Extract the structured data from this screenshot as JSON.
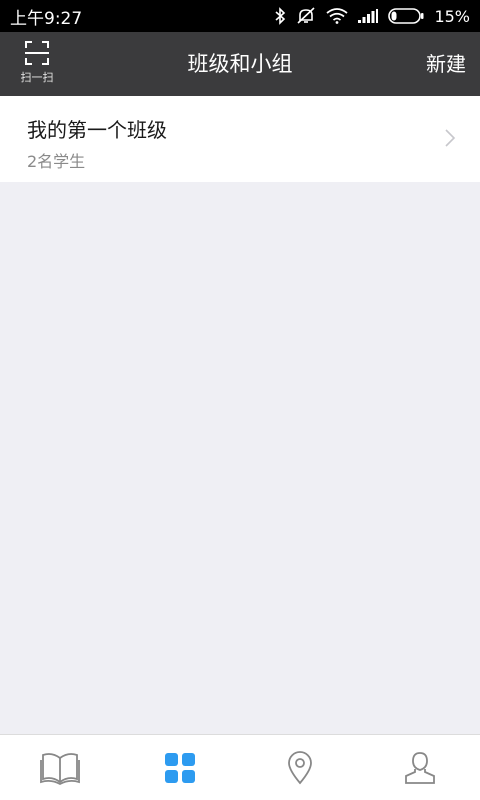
{
  "status_bar": {
    "time": "上午9:27",
    "battery": "15%",
    "icons": [
      "bluetooth-icon",
      "mute-icon",
      "wifi-icon",
      "signal-icon",
      "battery-icon"
    ]
  },
  "nav": {
    "scan_label": "扫一扫",
    "title": "班级和小组",
    "new_label": "新建"
  },
  "classes": [
    {
      "name": "我的第一个班级",
      "subtitle": "2名学生"
    }
  ],
  "tabs": [
    {
      "icon": "book-icon",
      "active": false
    },
    {
      "icon": "grid-icon",
      "active": true
    },
    {
      "icon": "location-pin-icon",
      "active": false
    },
    {
      "icon": "user-icon",
      "active": false
    }
  ],
  "colors": {
    "nav_bg": "#3b3b3d",
    "accent": "#2d9bf0",
    "page_bg": "#efeff4"
  }
}
